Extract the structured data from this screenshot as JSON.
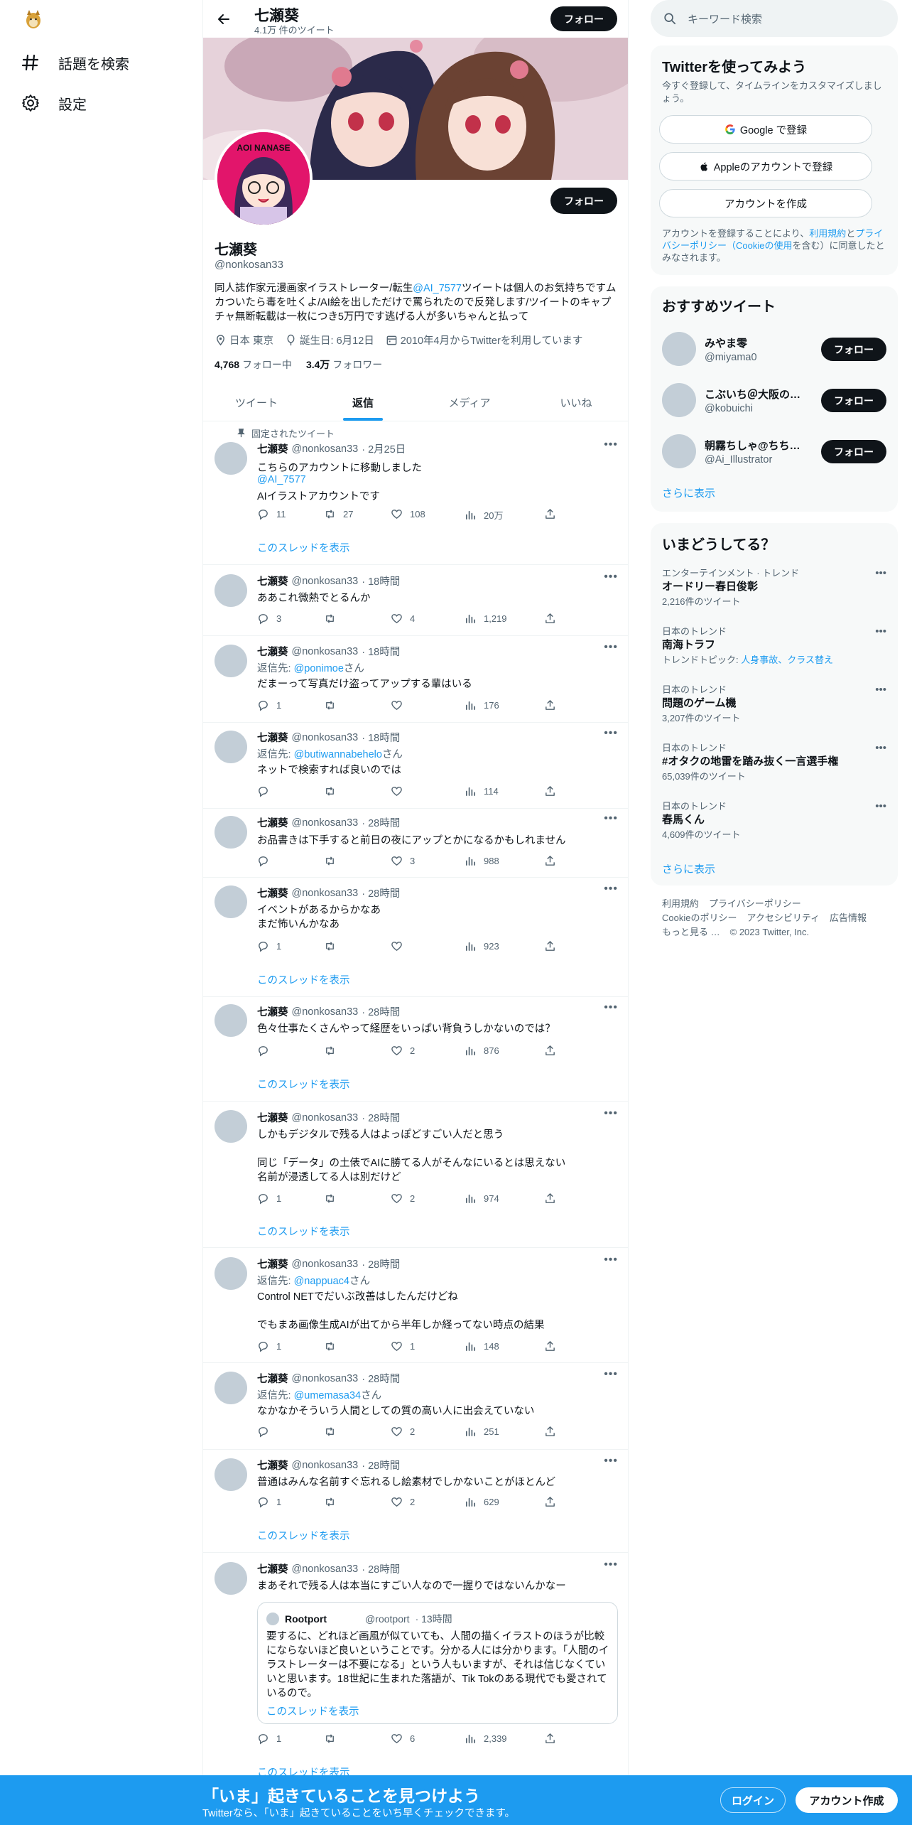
{
  "nav": {
    "explore_label": "話題を検索",
    "settings_label": "設定"
  },
  "header": {
    "name": "七瀬葵",
    "tweet_count": "4.1万 件のツイート",
    "follow_label": "フォロー"
  },
  "banner": {
    "avatar_text": "AOI NANASE"
  },
  "profile": {
    "name": "七瀬葵",
    "handle": "@nonkosan33",
    "follow_label": "フォロー",
    "bio_1": "同人誌作家元漫画家イラストレーター/転生",
    "bio_link": "@AI_7577",
    "bio_2": "ツイートは個人のお気持ちですムカついたら毒を吐くよ/AI絵を出しただけで罵られたので反発します/ツイートのキャプチャ無断転載は一枚につき5万円です逃げる人が多いちゃんと払って",
    "location": "日本 東京",
    "birthday": "誕生日: 6月12日",
    "joined": "2010年4月からTwitterを利用しています",
    "following_count": "4,768",
    "following_label": "フォロー中",
    "followers_count": "3.4万",
    "followers_label": "フォロワー"
  },
  "tabs": [
    "ツイート",
    "返信",
    "メディア",
    "いいね"
  ],
  "pinned_label": "固定されたツイート",
  "thread_label": "このスレッドを表示",
  "tweets": [
    {
      "name": "七瀬葵",
      "handle": "@nonkosan33",
      "time": "· 2月25日",
      "l1": "こちらのアカウントに移動しました",
      "l2": "@AI_7577",
      "l3": " AIイラストアカウントです",
      "reply": "11",
      "rt": "27",
      "like": "108",
      "views": "20万"
    },
    {
      "name": "七瀬葵",
      "handle": "@nonkosan33",
      "time": "· 18時間",
      "l1": "ああこれ微熱でとるんか",
      "reply": "3",
      "rt": "",
      "like": "4",
      "views": "1,219"
    },
    {
      "name": "七瀬葵",
      "handle": "@nonkosan33",
      "time": "· 18時間",
      "reply_to_label": "返信先: ",
      "reply_to": "@ponimoe",
      "reply_to_suffix": "さん",
      "l1": "だまーって写真だけ盗ってアップする輩はいる",
      "reply": "1",
      "rt": "",
      "like": "",
      "views": "176"
    },
    {
      "name": "七瀬葵",
      "handle": "@nonkosan33",
      "time": "· 18時間",
      "reply_to_label": "返信先: ",
      "reply_to": "@butiwannabehelo",
      "reply_to_suffix": "さん",
      "l1": "ネットで検索すれば良いのでは",
      "reply": "",
      "rt": "",
      "like": "",
      "views": "114"
    },
    {
      "name": "七瀬葵",
      "handle": "@nonkosan33",
      "time": "· 28時間",
      "l1": "お品書きは下手すると前日の夜にアップとかになるかもしれません",
      "reply": "",
      "rt": "",
      "like": "3",
      "views": "988"
    },
    {
      "name": "七瀬葵",
      "handle": "@nonkosan33",
      "time": "· 28時間",
      "l1": "イベントがあるからかなあ",
      "l2": "まだ怖いんかなあ",
      "reply": "1",
      "rt": "",
      "like": "",
      "views": "923"
    },
    {
      "name": "七瀬葵",
      "handle": "@nonkosan33",
      "time": "· 28時間",
      "l1": "色々仕事たくさんやって経歴をいっぱい背負うしかないのでは？",
      "reply": "",
      "rt": "",
      "like": "2",
      "views": "876"
    },
    {
      "name": "七瀬葵",
      "handle": "@nonkosan33",
      "time": "· 28時間",
      "l1": "しかもデジタルで残る人はよっぽどすごい人だと思う",
      "l2": "同じ「データ」の土俵でAIに勝てる人がそんなにいるとは思えない",
      "l3": "名前が浸透してる人は別だけど",
      "reply": "1",
      "rt": "",
      "like": "2",
      "views": "974"
    },
    {
      "name": "七瀬葵",
      "handle": "@nonkosan33",
      "time": "· 28時間",
      "reply_to_label": "返信先: ",
      "reply_to": "@nappuac4",
      "reply_to_suffix": "さん",
      "l1": "Control NETでだいぶ改善はしたんだけどね",
      "l2": "でもまあ画像生成AIが出てから半年しか経ってない時点の結果",
      "reply": "1",
      "rt": "",
      "like": "1",
      "views": "148"
    },
    {
      "name": "七瀬葵",
      "handle": "@nonkosan33",
      "time": "· 28時間",
      "reply_to_label": "返信先: ",
      "reply_to": "@umemasa34",
      "reply_to_suffix": "さん",
      "l1": "なかなかそういう人間としての質の高い人に出会えていない",
      "reply": "",
      "rt": "",
      "like": "2",
      "views": "251"
    },
    {
      "name": "七瀬葵",
      "handle": "@nonkosan33",
      "time": "· 28時間",
      "l1": "普通はみんな名前すぐ忘れるし絵素材でしかないことがほとんど",
      "reply": "1",
      "rt": "",
      "like": "2",
      "views": "629"
    },
    {
      "name": "七瀬葵",
      "handle": "@nonkosan33",
      "time": "· 28時間",
      "l1": "まあそれで残る人は本当にすごい人なので一握りではないんかなー",
      "reply": "1",
      "rt": "",
      "like": "6",
      "views": "2,339"
    }
  ],
  "quote": {
    "name": "Rootport",
    "handle": "@rootport",
    "time": "· 13時間",
    "body": "要するに、どれほど画風が似ていても、人間の描くイラストのほうが比較にならないほど良いということです。分かる人には分かります。「人間のイラストレーターは不要になる」という人もいますが、それは信じなくていいと思います。18世紀に生まれた落語が、Tik Tokのある現代でも愛されているので。",
    "thread_label": "このスレッドを表示"
  },
  "search": {
    "placeholder": "キーワード検索"
  },
  "signup_card": {
    "title": "Twitterを使ってみよう",
    "subtitle": "今すぐ登録して、タイムラインをカスタマイズしましょう。",
    "google_label": "Google で登録",
    "apple_label": "Appleのアカウントで登録",
    "create_label": "アカウントを作成",
    "terms_1": "アカウントを登録することにより、",
    "terms_link1": "利用規約",
    "terms_2": "と",
    "terms_link2": "プライバシーポリシー（Cookieの使用",
    "terms_3": "を含む）に同意したとみなされます。"
  },
  "recommended": {
    "title": "おすすめツイート",
    "follow_label": "フォロー",
    "users": [
      {
        "name": "みやま零",
        "handle": "@miyama0"
      },
      {
        "name": "こぶいち＠大阪のど…",
        "handle": "@kobuichi"
      },
      {
        "name": "朝霧ちしゃ@ちちぶ…",
        "handle": "@Ai_Illustrator"
      }
    ],
    "more_label": "さらに表示"
  },
  "trends": {
    "title": "いまどうしてる？",
    "items": [
      {
        "category": "エンターテインメント · トレンド",
        "title": "オードリー春日俊彰",
        "sub": "2,216件のツイート"
      },
      {
        "category": "日本のトレンド",
        "title": "南海トラフ",
        "sub_prefix": "トレンドトピック: ",
        "sub_link": "人身事故、クラス替え"
      },
      {
        "category": "日本のトレンド",
        "title": "問題のゲーム機",
        "sub": "3,207件のツイート"
      },
      {
        "category": "日本のトレンド",
        "title": "#オタクの地雷を踏み抜く一言選手権",
        "sub": "65,039件のツイート"
      },
      {
        "category": "日本のトレンド",
        "title": "春馬くん",
        "sub": "4,609件のツイート"
      }
    ],
    "more_label": "さらに表示"
  },
  "footer": {
    "terms": "利用規約",
    "privacy": "プライバシーポリシー",
    "cookie": "Cookieのポリシー",
    "accessibility": "アクセシビリティ",
    "ads": "広告情報",
    "more": "もっと見る …",
    "copyright": "© 2023 Twitter, Inc."
  },
  "bottom_bar": {
    "title": "「いま」起きていることを見つけよう",
    "subtitle": "Twitterなら、「いま」起きていることをいち早くチェックできます。",
    "login_label": "ログイン",
    "signup_label": "アカウント作成"
  },
  "colors": {
    "accent": "#1d9bf0",
    "text": "#0f1419",
    "muted": "#536471",
    "border": "#eff3f4",
    "card_bg": "#f7f9f9",
    "avatar_bg": "#e2156b"
  }
}
